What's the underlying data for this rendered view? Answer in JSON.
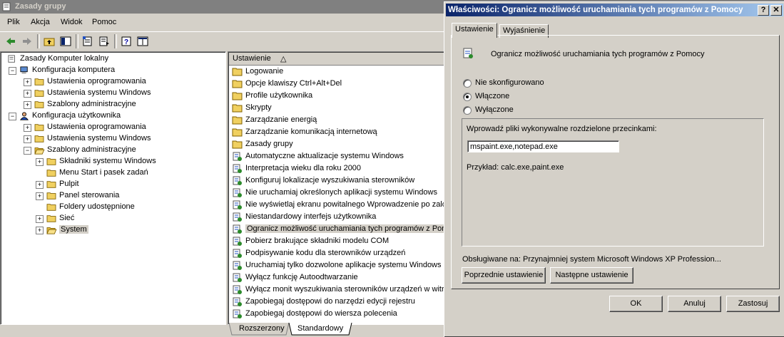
{
  "main_window": {
    "title": "Zasady grupy",
    "menu": [
      "Plik",
      "Akcja",
      "Widok",
      "Pomoc"
    ]
  },
  "tree": {
    "items": [
      {
        "label": "Zasady Komputer lokalny",
        "level": 0,
        "expander": "",
        "icon": "policy-icon"
      },
      {
        "label": "Konfiguracja komputera",
        "level": 1,
        "expander": "−",
        "icon": "computer-icon"
      },
      {
        "label": "Ustawienia oprogramowania",
        "level": 2,
        "expander": "+",
        "icon": "folder-icon"
      },
      {
        "label": "Ustawienia systemu Windows",
        "level": 2,
        "expander": "+",
        "icon": "folder-icon"
      },
      {
        "label": "Szablony administracyjne",
        "level": 2,
        "expander": "+",
        "icon": "folder-icon"
      },
      {
        "label": "Konfiguracja użytkownika",
        "level": 1,
        "expander": "−",
        "icon": "user-icon"
      },
      {
        "label": "Ustawienia oprogramowania",
        "level": 2,
        "expander": "+",
        "icon": "folder-icon"
      },
      {
        "label": "Ustawienia systemu Windows",
        "level": 2,
        "expander": "+",
        "icon": "folder-icon"
      },
      {
        "label": "Szablony administracyjne",
        "level": 2,
        "expander": "−",
        "icon": "folder-open-icon"
      },
      {
        "label": "Składniki systemu Windows",
        "level": 3,
        "expander": "+",
        "icon": "folder-icon"
      },
      {
        "label": "Menu Start i pasek zadań",
        "level": 3,
        "expander": "",
        "icon": "folder-icon"
      },
      {
        "label": "Pulpit",
        "level": 3,
        "expander": "+",
        "icon": "folder-icon"
      },
      {
        "label": "Panel sterowania",
        "level": 3,
        "expander": "+",
        "icon": "folder-icon"
      },
      {
        "label": "Foldery udostępnione",
        "level": 3,
        "expander": "",
        "icon": "folder-icon"
      },
      {
        "label": "Sieć",
        "level": 3,
        "expander": "+",
        "icon": "folder-icon"
      },
      {
        "label": "System",
        "level": 3,
        "expander": "+",
        "icon": "folder-open-icon",
        "selected": true
      }
    ]
  },
  "list": {
    "header": "Ustawienie",
    "sort_arrow": "△",
    "items": [
      {
        "label": "Logowanie",
        "type": "folder"
      },
      {
        "label": "Opcje klawiszy Ctrl+Alt+Del",
        "type": "folder"
      },
      {
        "label": "Profile użytkownika",
        "type": "folder"
      },
      {
        "label": "Skrypty",
        "type": "folder"
      },
      {
        "label": "Zarządzanie energią",
        "type": "folder"
      },
      {
        "label": "Zarządzanie komunikacją internetową",
        "type": "folder"
      },
      {
        "label": "Zasady grupy",
        "type": "folder"
      },
      {
        "label": "Automatyczne aktualizacje systemu Windows",
        "type": "setting"
      },
      {
        "label": "Interpretacja wieku dla roku 2000",
        "type": "setting"
      },
      {
        "label": "Konfiguruj lokalizacje wyszukiwania sterowników",
        "type": "setting"
      },
      {
        "label": "Nie uruchamiaj określonych aplikacji systemu Windows",
        "type": "setting"
      },
      {
        "label": "Nie wyświetlaj ekranu powitalnego Wprowadzenie po zalog",
        "type": "setting"
      },
      {
        "label": "Niestandardowy interfejs użytkownika",
        "type": "setting"
      },
      {
        "label": "Ogranicz możliwość uruchamiania tych programów z Pomocy",
        "type": "setting",
        "selected": true
      },
      {
        "label": "Pobierz brakujące składniki modelu COM",
        "type": "setting"
      },
      {
        "label": "Podpisywanie kodu dla sterowników urządzeń",
        "type": "setting"
      },
      {
        "label": "Uruchamiaj tylko dozwolone aplikacje systemu Windows",
        "type": "setting"
      },
      {
        "label": "Wyłącz funkcję Autoodtwarzanie",
        "type": "setting"
      },
      {
        "label": "Wyłącz monit wyszukiwania sterowników urządzeń w witryr",
        "type": "setting"
      },
      {
        "label": "Zapobiegaj dostępowi do narzędzi edycji rejestru",
        "type": "setting"
      },
      {
        "label": "Zapobiegaj dostępowi do wiersza polecenia",
        "type": "setting"
      }
    ],
    "bottom_tabs": [
      "Rozszerzony",
      "Standardowy"
    ]
  },
  "dialog": {
    "title": "Właściwości: Ogranicz możliwość uruchamiania tych programów z Pomocy",
    "help_btn": "?",
    "close_btn": "✕",
    "tabs": [
      "Ustawienie",
      "Wyjaśnienie"
    ],
    "setting_name": "Ogranicz możliwość uruchamiania tych programów z Pomocy",
    "radios": [
      {
        "label": "Nie skonfigurowano",
        "checked": false
      },
      {
        "label": "Włączone",
        "checked": true
      },
      {
        "label": "Wyłączone",
        "checked": false
      }
    ],
    "options_label": "Wprowadź pliki wykonywalne rozdzielone przecinkami:",
    "exe_value": "mspaint.exe,notepad.exe",
    "example": "Przykład: calc.exe,paint.exe",
    "supported": "Obsługiwane na:  Przynajmniej system Microsoft Windows XP Profession...",
    "prev_btn": "Poprzednie ustawienie",
    "next_btn": "Następne ustawienie",
    "ok": "OK",
    "cancel": "Anuluj",
    "apply": "Zastosuj"
  }
}
